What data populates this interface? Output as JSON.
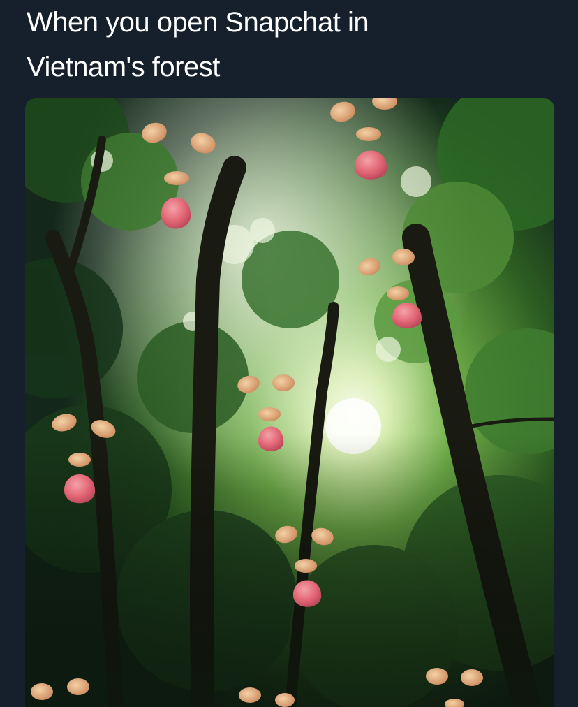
{
  "post": {
    "caption_line1": "When you open Snapchat in",
    "caption_line2": "Vietnam's forest"
  },
  "image": {
    "description_icon": "forest-canopy-with-snapchat-filter-faces",
    "colors": {
      "background": "#16202d",
      "foliage_dark": "#16301a",
      "foliage_mid": "#2f6a27",
      "foliage_light": "#8cc466",
      "sky": "#f3f7e8",
      "trunk": "#1a1c14",
      "filter_blob": "#e46b78",
      "filter_ear": "#d9a070"
    }
  }
}
